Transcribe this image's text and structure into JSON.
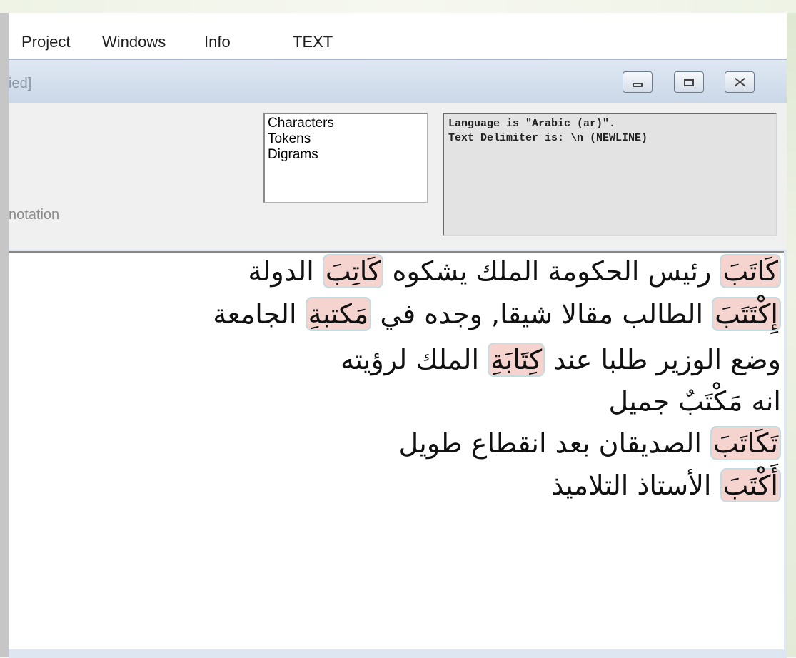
{
  "menu": {
    "items": [
      "Project",
      "Windows",
      "Info",
      "TEXT"
    ]
  },
  "window": {
    "title_fragment": "ied]",
    "buttons": {
      "minimize": "minimize-icon",
      "maximize": "maximize-icon",
      "close": "close-icon"
    }
  },
  "panel": {
    "annotation_label": "notation",
    "list_items": [
      "Characters",
      "Tokens",
      "Digrams"
    ],
    "info_lines": [
      "Language is \"Arabic (ar)\".",
      "Text Delimiter is: \\n (NEWLINE)"
    ]
  },
  "text": {
    "highlight_color": "#f5d3cf",
    "lines": [
      {
        "hl1": "كَاتَبَ",
        "t1": " رئيس الحكومة الملك يشكوه ",
        "hl2": "كَاتِبَ",
        "t2": " الدولة"
      },
      {
        "hl1": "إِكْتَتَبَ",
        "t1": " الطالب مقالا شيقا, وجده في ",
        "hl2": "مَكتبةِ",
        "t2": " الجامعة"
      },
      {
        "t0": "وضع الوزير طلبا عند ",
        "hl1": "كِتَابَةِ",
        "t1": " الملك لرؤيته"
      },
      {
        "t0": "انه مَكْتَبٌ جميل"
      },
      {
        "hl1": "تَكَاتَبَ",
        "t1": " الصديقان بعد انقطاع طويل"
      },
      {
        "hl1": "أَكْتَبَ",
        "t1": " الأستاذ التلاميذ"
      }
    ]
  }
}
